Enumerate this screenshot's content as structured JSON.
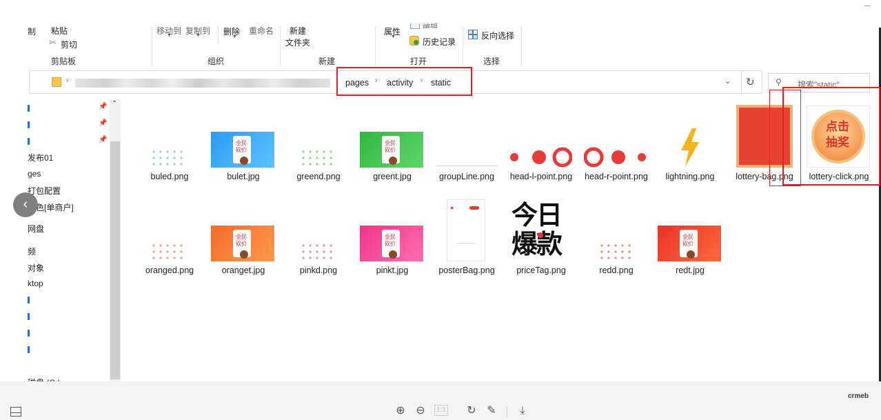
{
  "ribbon": {
    "clipboard": {
      "fragment": "制",
      "paste": "粘贴",
      "cut": "剪切",
      "group_label": "剪贴板"
    },
    "organize": {
      "move_to": "移动到",
      "copy_to": "复制到",
      "delete": "删除",
      "rename": "重命名",
      "group_label": "组织"
    },
    "new": {
      "new_folder_line1": "新建",
      "new_folder_line2": "文件夹",
      "group_label": "新建"
    },
    "open": {
      "properties": "属性",
      "edit": "编辑",
      "history": "历史记录",
      "group_label": "打开"
    },
    "select": {
      "invert_selection": "反向选择",
      "group_label": "选择"
    }
  },
  "address_bar": {
    "breadcrumb": [
      "pages",
      "activity",
      "static"
    ],
    "search_placeholder": "搜索\"static\""
  },
  "nav_pane": {
    "items": [
      "发布01",
      "ges",
      "打包配置",
      "换色[单商户]",
      "网盘",
      "频",
      "对象",
      "ktop",
      "磁盘 (C:)"
    ]
  },
  "files": [
    {
      "name": "buled.png",
      "thumb": "dots-blue"
    },
    {
      "name": "bulet.jpg",
      "thumb": "poster-blue"
    },
    {
      "name": "greend.png",
      "thumb": "dots-green"
    },
    {
      "name": "greent.jpg",
      "thumb": "poster-green"
    },
    {
      "name": "groupLine.png",
      "thumb": "line"
    },
    {
      "name": "head-l-point.png",
      "thumb": "head-l"
    },
    {
      "name": "head-r-point.png",
      "thumb": "head-r"
    },
    {
      "name": "lightning.png",
      "thumb": "lightning"
    },
    {
      "name": "lottery-bag.png",
      "thumb": "lottery-bag"
    },
    {
      "name": "lottery-click.png",
      "thumb": "lottery-click"
    },
    {
      "name": "oranged.png",
      "thumb": "dots-orange"
    },
    {
      "name": "oranget.jpg",
      "thumb": "poster-orange"
    },
    {
      "name": "pinkd.png",
      "thumb": "dots-pink"
    },
    {
      "name": "pinkt.jpg",
      "thumb": "poster-pink"
    },
    {
      "name": "posterBag.png",
      "thumb": "poster-bag"
    },
    {
      "name": "priceTag.png",
      "thumb": "price-tag"
    },
    {
      "name": "redd.png",
      "thumb": "dots-red"
    },
    {
      "name": "redt.jpg",
      "thumb": "poster-red"
    }
  ],
  "thumb_text": {
    "poster_line1": "全民",
    "poster_line2": "砍价",
    "lottery_click_line1": "点击",
    "lottery_click_line2": "抽奖",
    "price_tag_line1": "今日",
    "price_tag_line2": "爆款"
  },
  "watermark": "crmeb",
  "colors": {
    "highlight": "#e02020",
    "accent_blue": "#2a6fd6"
  }
}
